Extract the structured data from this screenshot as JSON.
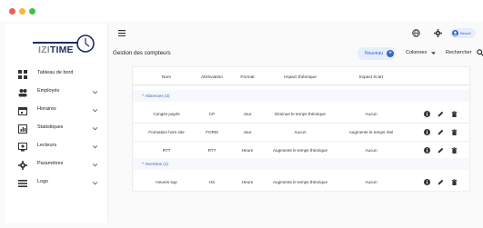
{
  "window_controls": {
    "close_color": "#ee5c54",
    "minimize_color": "#f5b53a",
    "maximize_color": "#3fc24a"
  },
  "brand": {
    "logo_izi": "IZI",
    "logo_time": "TIME",
    "primary_color": "#1f2d5c",
    "accent_color": "#3b64c5"
  },
  "sidebar": {
    "items": [
      {
        "label": "Tableau de bord",
        "icon": "dashboard-icon",
        "has_children": false
      },
      {
        "label": "Employés",
        "icon": "users-icon",
        "has_children": true
      },
      {
        "label": "Horaires",
        "icon": "calendar-icon",
        "has_children": true
      },
      {
        "label": "Statistiques",
        "icon": "chart-icon",
        "has_children": true
      },
      {
        "label": "Lecteurs",
        "icon": "reader-icon",
        "has_children": true
      },
      {
        "label": "Paramètres",
        "icon": "gear-icon",
        "has_children": true
      },
      {
        "label": "Logs",
        "icon": "list-icon",
        "has_children": true
      }
    ]
  },
  "topbar": {
    "menu_icon": "hamburger-icon",
    "globe_icon": "globe-icon",
    "settings_icon": "gear-icon",
    "user_name": "Benoît"
  },
  "main": {
    "title": "Gestion des compteurs",
    "new_button_label": "Nouveau",
    "columns_label": "Colonnes",
    "search_label": "Rechercher"
  },
  "table": {
    "headers": [
      "Nom",
      "Abréviation",
      "Format",
      "Impact théorique",
      "Impact écart"
    ],
    "groups": [
      {
        "label": "Absences (3)",
        "rows": [
          [
            "Congés payés",
            "CP",
            "Jour",
            "Diminue le temps théorique",
            "Aucun"
          ],
          [
            "Formation hors site",
            "FORM",
            "Jour",
            "Aucun",
            "Augmente le temps réel"
          ],
          [
            "RTT",
            "RTT",
            "Heure",
            "Augmente le temps théorique",
            "Aucun"
          ]
        ]
      },
      {
        "label": "Overtime (1)",
        "rows": [
          [
            "Heures sup",
            "HS",
            "Heure",
            "Augmente le temps théorique",
            "Aucun"
          ]
        ]
      }
    ]
  }
}
